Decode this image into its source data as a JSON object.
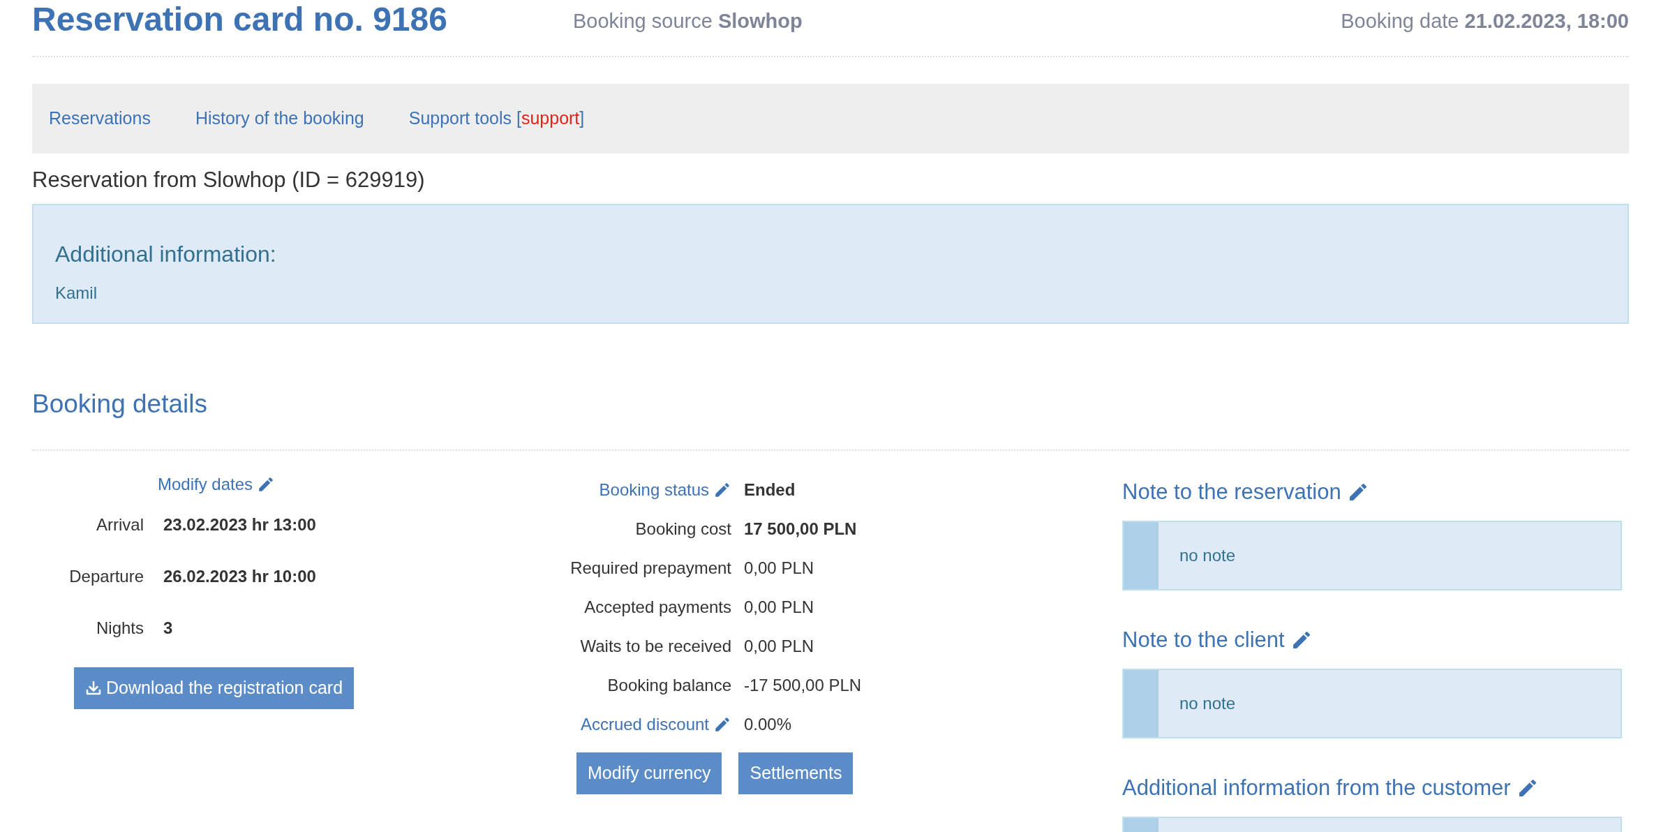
{
  "header": {
    "title": "Reservation card no. 9186",
    "source": "Booking source **Slowhop**",
    "date": "Booking date **21.02.2023, 18:00**"
  },
  "tabs": [
    {
      "parts": [
        {
          "kind": "text",
          "text": "Reservations"
        }
      ]
    },
    {
      "parts": [
        {
          "kind": "text",
          "text": "History of the booking"
        }
      ]
    },
    {
      "parts": [
        {
          "kind": "text",
          "text": "Support tools ["
        },
        {
          "kind": "alert",
          "text": "support"
        },
        {
          "kind": "text",
          "text": "]"
        }
      ]
    }
  ],
  "reservation_source": "Reservation from Slowhop (ID = 629919)",
  "info_box": {
    "heading": "Additional information:",
    "text": "Kamil"
  },
  "section_title": "Booking details",
  "dates": {
    "modify_link": "Modify dates",
    "rows": [
      {
        "label": "Arrival",
        "value": "23.02.2023 hr 13:00"
      },
      {
        "label": "Departure",
        "value": "26.02.2023 hr 10:00"
      },
      {
        "label": "Nights",
        "value": "3"
      }
    ],
    "download_button": "Download the registration card"
  },
  "finance": {
    "rows": [
      {
        "kind": "link",
        "label": "Booking status",
        "value": "Ended",
        "bold": true
      },
      {
        "kind": "plain",
        "label": "Booking cost",
        "value": "17 500,00 PLN",
        "bold": true
      },
      {
        "kind": "plain",
        "label": "Required prepayment",
        "value": "0,00 PLN",
        "bold": false
      },
      {
        "kind": "plain",
        "label": "Accepted payments",
        "value": "0,00 PLN",
        "bold": false
      },
      {
        "kind": "plain",
        "label": "Waits to be received",
        "value": "0,00 PLN",
        "bold": false
      },
      {
        "kind": "plain",
        "label": "Booking balance",
        "value": "-17 500,00 PLN",
        "bold": false
      },
      {
        "kind": "link",
        "label": "Accrued discount",
        "value": "0.00%",
        "bold": false
      }
    ],
    "buttons": [
      "Modify currency",
      "Settlements"
    ]
  },
  "notes": [
    {
      "title": "Note to the reservation",
      "text": "no note"
    },
    {
      "title": "Note to the client",
      "text": "no note"
    },
    {
      "title": "Additional information from the customer"
    }
  ]
}
